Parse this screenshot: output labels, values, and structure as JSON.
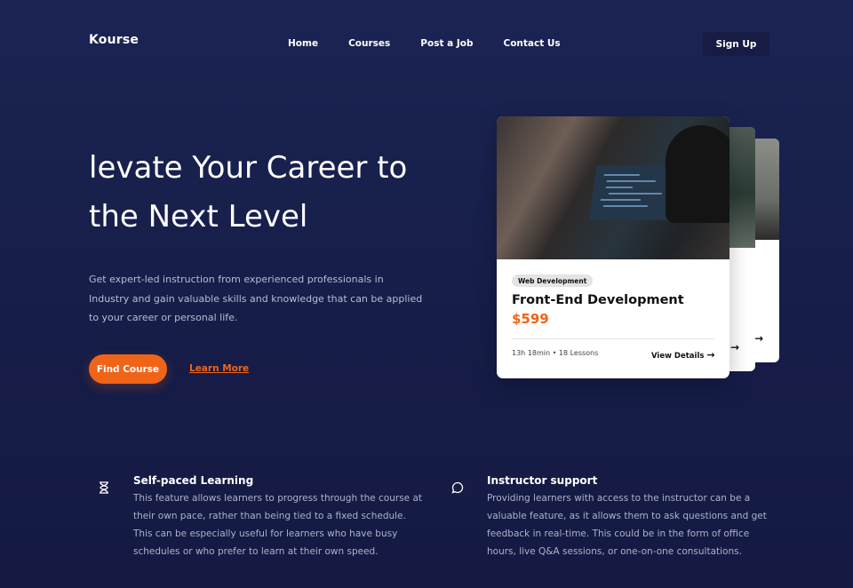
{
  "header": {
    "logo": "Kourse",
    "nav": [
      "Home",
      "Courses",
      "Post a Job",
      "Contact Us"
    ],
    "signup": "Sign Up"
  },
  "hero": {
    "title_line1": "levate Your Career to",
    "title_line2": "the Next Level",
    "description": "Get expert-led instruction from experienced professionals in Industry and gain valuable skills and knowledge that can be applied to your career or personal life.",
    "primary_button": "Find Course",
    "secondary_link": "Learn More"
  },
  "course_card": {
    "category": "Web Development",
    "title": "Front-End Development",
    "price": "$599",
    "meta": "13h 18min • 18 Lessons",
    "cta": "View Details"
  },
  "features": [
    {
      "icon": "hourglass-icon",
      "title": "Self-paced Learning",
      "description": "This feature allows learners to progress through the course at their own pace, rather than being tied to a fixed schedule. This can be especially useful for learners who have busy schedules or who prefer to learn at their own speed."
    },
    {
      "icon": "chat-bubble-icon",
      "title": "Instructor support",
      "description": "Providing learners with access to the instructor can be a valuable feature, as it allows them to ask questions and get feedback in real-time. This could be in the form of office hours, live Q&A sessions, or one-on-one consultations."
    }
  ],
  "colors": {
    "background": "#1b2453",
    "accent": "#f06418",
    "card": "#ffffff"
  }
}
